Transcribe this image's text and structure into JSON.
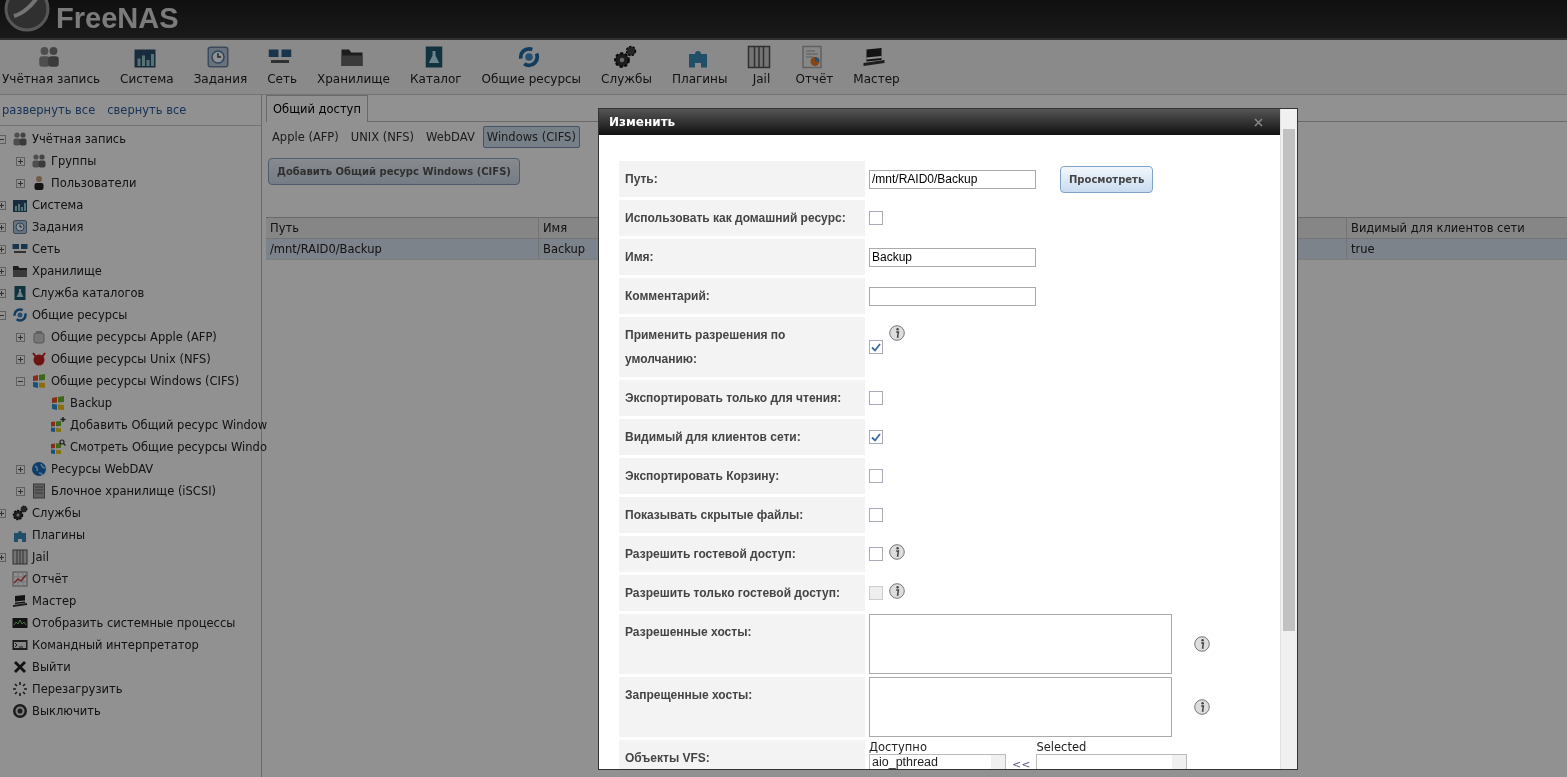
{
  "header": {
    "logo": "FreeNAS"
  },
  "toolbar": [
    {
      "label": "Учётная запись"
    },
    {
      "label": "Система"
    },
    {
      "label": "Задания"
    },
    {
      "label": "Сеть"
    },
    {
      "label": "Хранилище"
    },
    {
      "label": "Каталог"
    },
    {
      "label": "Общие ресурсы"
    },
    {
      "label": "Службы"
    },
    {
      "label": "Плагины"
    },
    {
      "label": "Jail"
    },
    {
      "label": "Отчёт"
    },
    {
      "label": "Мастер"
    }
  ],
  "sidebar": {
    "expand_all": "развернуть все",
    "collapse_all": "свернуть все",
    "tree": [
      {
        "label": "Учётная запись",
        "expanded": true,
        "children": [
          {
            "label": "Группы",
            "expanded": false
          },
          {
            "label": "Пользователи",
            "expanded": false
          }
        ]
      },
      {
        "label": "Система",
        "expanded": false
      },
      {
        "label": "Задания",
        "expanded": false
      },
      {
        "label": "Сеть",
        "expanded": false
      },
      {
        "label": "Хранилище",
        "expanded": false
      },
      {
        "label": "Служба каталогов",
        "expanded": false
      },
      {
        "label": "Общие ресурсы",
        "expanded": true,
        "children": [
          {
            "label": "Общие ресурсы Apple (AFP)",
            "expanded": false
          },
          {
            "label": "Общие ресурсы Unix (NFS)",
            "expanded": false
          },
          {
            "label": "Общие ресурсы Windows (CIFS)",
            "expanded": true,
            "children": [
              {
                "label": "Backup"
              },
              {
                "label": "Добавить Общий ресурс Window"
              },
              {
                "label": "Смотреть Общие ресурсы Windo"
              }
            ]
          },
          {
            "label": "Ресурсы WebDAV",
            "expanded": false
          },
          {
            "label": "Блочное хранилище (iSCSI)",
            "expanded": false
          }
        ]
      },
      {
        "label": "Службы",
        "expanded": false
      },
      {
        "label": "Плагины"
      },
      {
        "label": "Jail",
        "expanded": false
      },
      {
        "label": "Отчёт"
      },
      {
        "label": "Мастер"
      },
      {
        "label": "Отобразить системные процессы"
      },
      {
        "label": "Командный интерпретатор"
      },
      {
        "label": "Выйти"
      },
      {
        "label": "Перезагрузить"
      },
      {
        "label": "Выключить"
      }
    ]
  },
  "main": {
    "tabs": [
      {
        "label": "Общий доступ",
        "selected": true
      }
    ],
    "subtabs": [
      {
        "label": "Apple (AFP)",
        "selected": false
      },
      {
        "label": "UNIX (NFS)",
        "selected": false
      },
      {
        "label": "WebDAV",
        "selected": false
      },
      {
        "label": "Windows (CIFS)",
        "selected": true
      }
    ],
    "add_button": "Добавить Общий ресурс Windows (CIFS)",
    "table": {
      "columns": [
        "Путь",
        "Имя",
        "Видимый для клиентов сети"
      ],
      "rows": [
        {
          "cells": [
            "/mnt/RAID0/Backup",
            "Backup",
            "true"
          ],
          "selected": true
        }
      ]
    }
  },
  "dialog": {
    "title": "Изменить",
    "fields": [
      {
        "kind": "text",
        "label": "Путь:",
        "value": "/mnt/RAID0/Backup",
        "button": "Просмотреть"
      },
      {
        "kind": "checkbox",
        "label": "Использовать как домашний ресурс:",
        "checked": false,
        "disabled": false,
        "info": false
      },
      {
        "kind": "text",
        "label": "Имя:",
        "value": "Backup"
      },
      {
        "kind": "text",
        "label": "Комментарий:"
      },
      {
        "kind": "checkbox",
        "label": "Применить разрешения по умолчанию:",
        "checked": true,
        "disabled": false,
        "info": true
      },
      {
        "kind": "checkbox",
        "label": "Экспортировать только для чтения:",
        "checked": false,
        "disabled": false,
        "info": false
      },
      {
        "kind": "checkbox",
        "label": "Видимый для клиентов сети:",
        "checked": true,
        "disabled": false,
        "info": false
      },
      {
        "kind": "checkbox",
        "label": "Экспортировать Корзину:",
        "checked": false,
        "disabled": false,
        "info": false
      },
      {
        "kind": "checkbox",
        "label": "Показывать скрытые файлы:",
        "checked": false,
        "disabled": false,
        "info": false
      },
      {
        "kind": "checkbox",
        "label": "Разрешить гостевой доступ:",
        "checked": false,
        "disabled": false,
        "info": true
      },
      {
        "kind": "checkbox",
        "label": "Разрешить только гостевой доступ:",
        "checked": false,
        "disabled": true,
        "info": true
      },
      {
        "kind": "textarea",
        "label": "Разрешенные хосты:",
        "info": true
      },
      {
        "kind": "textarea",
        "label": "Запрещенные хосты:",
        "info": true
      },
      {
        "kind": "vfs",
        "label": "Объекты VFS:",
        "available_label": "Доступно",
        "available": [
          "aio_pthread"
        ],
        "move": "<<",
        "selected_label": "Selected"
      }
    ]
  }
}
